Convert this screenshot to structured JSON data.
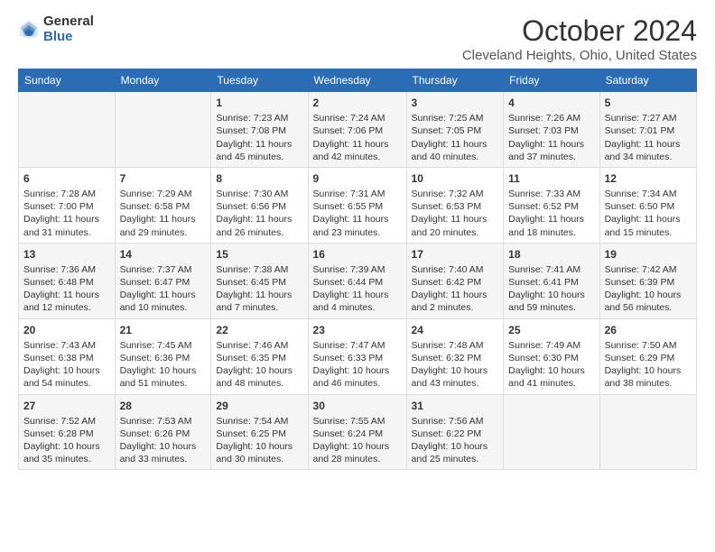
{
  "logo": {
    "general": "General",
    "blue": "Blue"
  },
  "title": "October 2024",
  "location": "Cleveland Heights, Ohio, United States",
  "days_of_week": [
    "Sunday",
    "Monday",
    "Tuesday",
    "Wednesday",
    "Thursday",
    "Friday",
    "Saturday"
  ],
  "weeks": [
    [
      {
        "day": "",
        "content": ""
      },
      {
        "day": "",
        "content": ""
      },
      {
        "day": "1",
        "content": "Sunrise: 7:23 AM\nSunset: 7:08 PM\nDaylight: 11 hours and 45 minutes."
      },
      {
        "day": "2",
        "content": "Sunrise: 7:24 AM\nSunset: 7:06 PM\nDaylight: 11 hours and 42 minutes."
      },
      {
        "day": "3",
        "content": "Sunrise: 7:25 AM\nSunset: 7:05 PM\nDaylight: 11 hours and 40 minutes."
      },
      {
        "day": "4",
        "content": "Sunrise: 7:26 AM\nSunset: 7:03 PM\nDaylight: 11 hours and 37 minutes."
      },
      {
        "day": "5",
        "content": "Sunrise: 7:27 AM\nSunset: 7:01 PM\nDaylight: 11 hours and 34 minutes."
      }
    ],
    [
      {
        "day": "6",
        "content": "Sunrise: 7:28 AM\nSunset: 7:00 PM\nDaylight: 11 hours and 31 minutes."
      },
      {
        "day": "7",
        "content": "Sunrise: 7:29 AM\nSunset: 6:58 PM\nDaylight: 11 hours and 29 minutes."
      },
      {
        "day": "8",
        "content": "Sunrise: 7:30 AM\nSunset: 6:56 PM\nDaylight: 11 hours and 26 minutes."
      },
      {
        "day": "9",
        "content": "Sunrise: 7:31 AM\nSunset: 6:55 PM\nDaylight: 11 hours and 23 minutes."
      },
      {
        "day": "10",
        "content": "Sunrise: 7:32 AM\nSunset: 6:53 PM\nDaylight: 11 hours and 20 minutes."
      },
      {
        "day": "11",
        "content": "Sunrise: 7:33 AM\nSunset: 6:52 PM\nDaylight: 11 hours and 18 minutes."
      },
      {
        "day": "12",
        "content": "Sunrise: 7:34 AM\nSunset: 6:50 PM\nDaylight: 11 hours and 15 minutes."
      }
    ],
    [
      {
        "day": "13",
        "content": "Sunrise: 7:36 AM\nSunset: 6:48 PM\nDaylight: 11 hours and 12 minutes."
      },
      {
        "day": "14",
        "content": "Sunrise: 7:37 AM\nSunset: 6:47 PM\nDaylight: 11 hours and 10 minutes."
      },
      {
        "day": "15",
        "content": "Sunrise: 7:38 AM\nSunset: 6:45 PM\nDaylight: 11 hours and 7 minutes."
      },
      {
        "day": "16",
        "content": "Sunrise: 7:39 AM\nSunset: 6:44 PM\nDaylight: 11 hours and 4 minutes."
      },
      {
        "day": "17",
        "content": "Sunrise: 7:40 AM\nSunset: 6:42 PM\nDaylight: 11 hours and 2 minutes."
      },
      {
        "day": "18",
        "content": "Sunrise: 7:41 AM\nSunset: 6:41 PM\nDaylight: 10 hours and 59 minutes."
      },
      {
        "day": "19",
        "content": "Sunrise: 7:42 AM\nSunset: 6:39 PM\nDaylight: 10 hours and 56 minutes."
      }
    ],
    [
      {
        "day": "20",
        "content": "Sunrise: 7:43 AM\nSunset: 6:38 PM\nDaylight: 10 hours and 54 minutes."
      },
      {
        "day": "21",
        "content": "Sunrise: 7:45 AM\nSunset: 6:36 PM\nDaylight: 10 hours and 51 minutes."
      },
      {
        "day": "22",
        "content": "Sunrise: 7:46 AM\nSunset: 6:35 PM\nDaylight: 10 hours and 48 minutes."
      },
      {
        "day": "23",
        "content": "Sunrise: 7:47 AM\nSunset: 6:33 PM\nDaylight: 10 hours and 46 minutes."
      },
      {
        "day": "24",
        "content": "Sunrise: 7:48 AM\nSunset: 6:32 PM\nDaylight: 10 hours and 43 minutes."
      },
      {
        "day": "25",
        "content": "Sunrise: 7:49 AM\nSunset: 6:30 PM\nDaylight: 10 hours and 41 minutes."
      },
      {
        "day": "26",
        "content": "Sunrise: 7:50 AM\nSunset: 6:29 PM\nDaylight: 10 hours and 38 minutes."
      }
    ],
    [
      {
        "day": "27",
        "content": "Sunrise: 7:52 AM\nSunset: 6:28 PM\nDaylight: 10 hours and 35 minutes."
      },
      {
        "day": "28",
        "content": "Sunrise: 7:53 AM\nSunset: 6:26 PM\nDaylight: 10 hours and 33 minutes."
      },
      {
        "day": "29",
        "content": "Sunrise: 7:54 AM\nSunset: 6:25 PM\nDaylight: 10 hours and 30 minutes."
      },
      {
        "day": "30",
        "content": "Sunrise: 7:55 AM\nSunset: 6:24 PM\nDaylight: 10 hours and 28 minutes."
      },
      {
        "day": "31",
        "content": "Sunrise: 7:56 AM\nSunset: 6:22 PM\nDaylight: 10 hours and 25 minutes."
      },
      {
        "day": "",
        "content": ""
      },
      {
        "day": "",
        "content": ""
      }
    ]
  ]
}
